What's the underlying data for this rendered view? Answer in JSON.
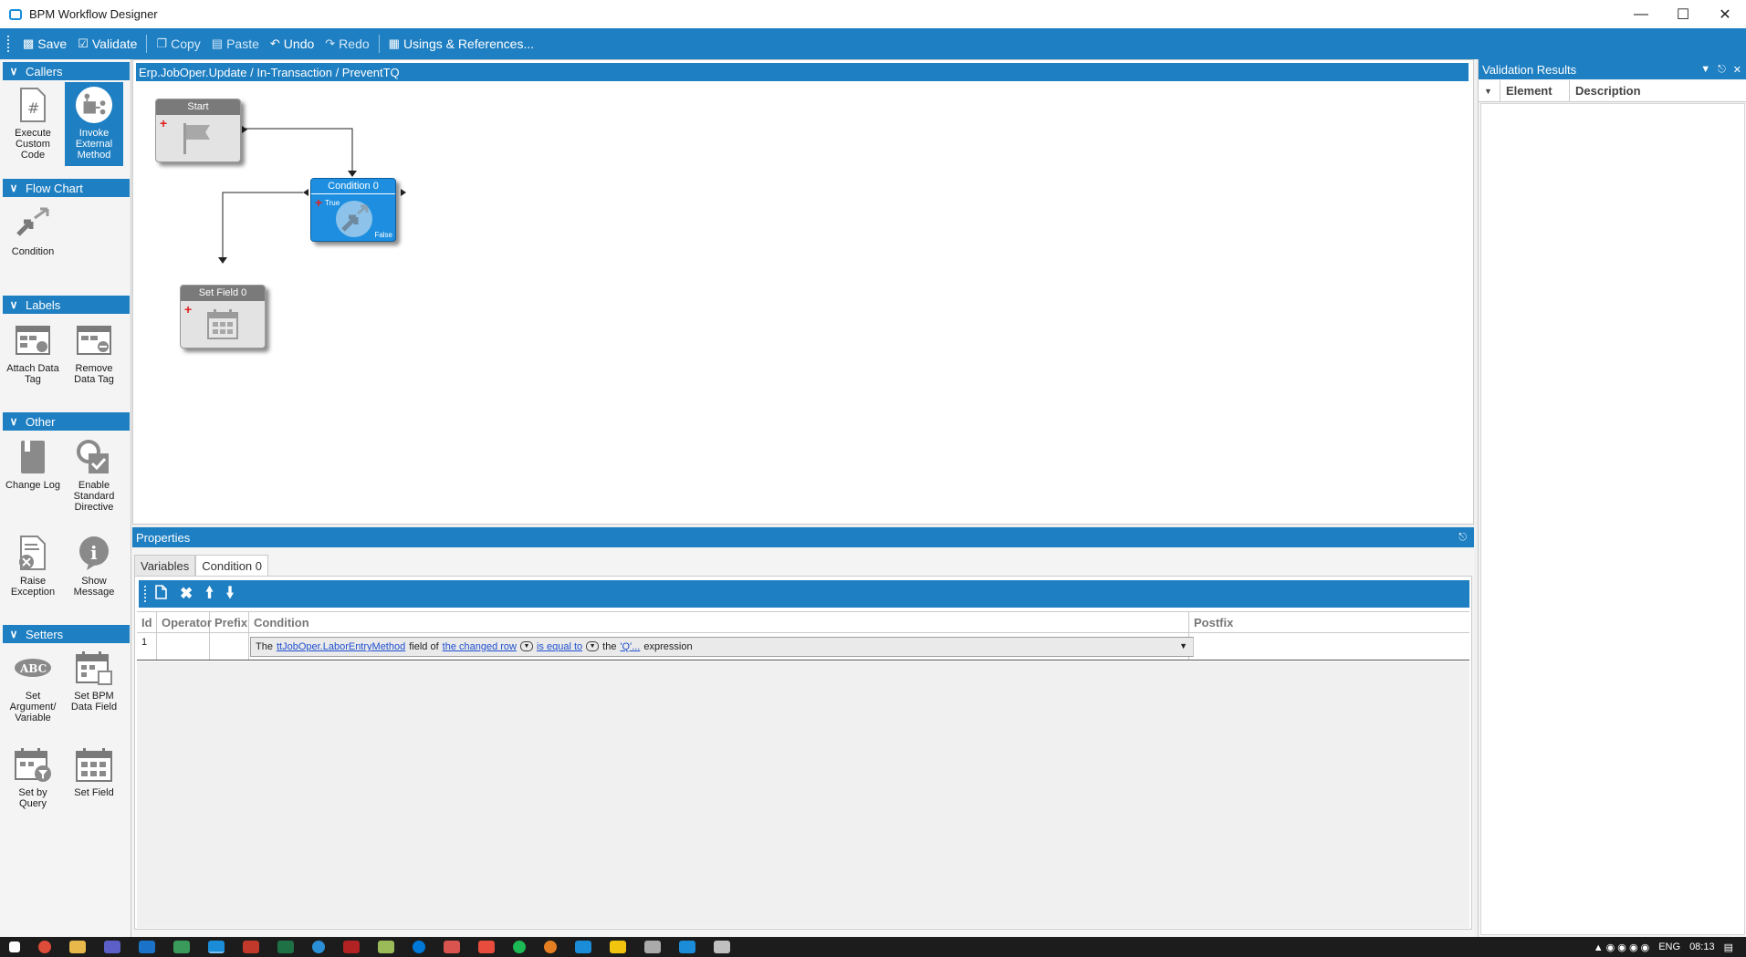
{
  "window": {
    "title": "BPM Workflow Designer",
    "minimize": "—",
    "maximize": "☐",
    "close": "✕"
  },
  "toolbar": {
    "save": "Save",
    "validate": "Validate",
    "copy": "Copy",
    "paste": "Paste",
    "undo": "Undo",
    "redo": "Redo",
    "usings": "Usings & References..."
  },
  "toolbox": {
    "callers": {
      "title": "Callers",
      "items": [
        {
          "label": "Execute Custom Code",
          "icon": "hash-document-icon"
        },
        {
          "label": "Invoke External Method",
          "icon": "external-method-icon"
        }
      ]
    },
    "flow_chart": {
      "title": "Flow Chart",
      "items": [
        {
          "label": "Condition",
          "icon": "condition-arrows-icon"
        }
      ]
    },
    "labels": {
      "title": "Labels",
      "items": [
        {
          "label": "Attach Data Tag",
          "icon": "attach-tag-icon"
        },
        {
          "label": "Remove Data Tag",
          "icon": "remove-tag-icon"
        }
      ]
    },
    "other": {
      "title": "Other",
      "items": [
        {
          "label": "Change Log",
          "icon": "book-icon"
        },
        {
          "label": "Enable Standard Directive",
          "icon": "enable-directive-icon"
        },
        {
          "label": "Raise Exception",
          "icon": "exception-icon"
        },
        {
          "label": "Show Message",
          "icon": "info-bubble-icon"
        }
      ]
    },
    "setters": {
      "title": "Setters",
      "items": [
        {
          "label": "Set Argument/ Variable",
          "icon": "abc-icon"
        },
        {
          "label": "Set BPM Data Field",
          "icon": "calendar-box-icon"
        },
        {
          "label": "Set by Query",
          "icon": "calendar-filter-icon"
        },
        {
          "label": "Set Field",
          "icon": "calendar-icon"
        }
      ]
    }
  },
  "canvas": {
    "breadcrumb": "Erp.JobOper.Update / In-Transaction / PreventTQ",
    "nodes": {
      "start": "Start",
      "condition": "Condition 0",
      "condition_true": "True",
      "condition_false": "False",
      "set_field": "Set Field 0"
    }
  },
  "validation": {
    "title": "Validation Results",
    "columns": [
      "Element",
      "Description"
    ]
  },
  "properties": {
    "title": "Properties",
    "tabs": [
      "Variables",
      "Condition 0"
    ],
    "grid": {
      "columns": [
        "Id",
        "Operator",
        "Prefix",
        "Condition",
        "Postfix"
      ],
      "row": {
        "id": "1",
        "operator": "",
        "prefix": "",
        "postfix": "",
        "condition": {
          "t1": "The",
          "link1": "ttJobOper.LaborEntryMethod",
          "t2": "field of",
          "link2": "the changed row",
          "link3": "is equal to",
          "t3": "the",
          "link4": "'Q'...",
          "t4": "expression"
        }
      }
    }
  },
  "taskbar": {
    "lang": "ENG",
    "time": "08:13"
  },
  "colors": {
    "accent": "#1e7fc2",
    "node_blue": "#1e8fe0",
    "link": "#1f4fd1"
  }
}
